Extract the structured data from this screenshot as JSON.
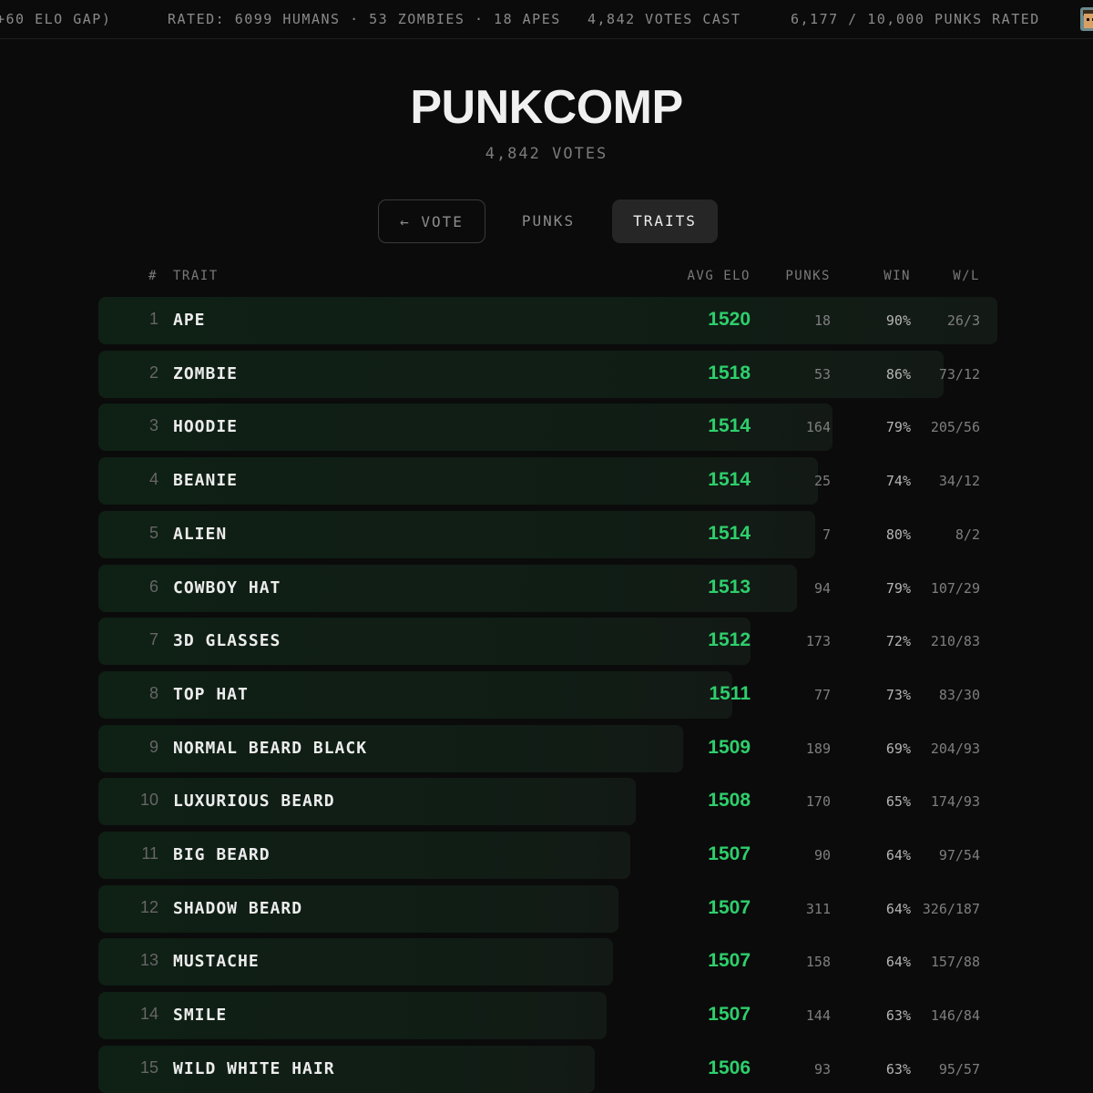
{
  "ticker": {
    "elo_gap": "+60 ELO GAP)",
    "rated": "RATED: 6099 HUMANS · 53 ZOMBIES · 18 APES",
    "votes_cast": "4,842 VOTES CAST",
    "punks_rated": "6,177 / 10,000 PUNKS RATED"
  },
  "header": {
    "title": "PUNKCOMP",
    "subtitle": "4,842 VOTES"
  },
  "tabs": {
    "vote": "← VOTE",
    "punks": "PUNKS",
    "traits": "TRAITS",
    "active": "traits"
  },
  "columns": {
    "rank": "#",
    "trait": "TRAIT",
    "avg_elo": "AVG ELO",
    "punks": "PUNKS",
    "win": "WIN",
    "wl": "W/L"
  },
  "accent_color": "#2ecf6c",
  "traits": [
    {
      "rank": "1",
      "name": "APE",
      "elo": "1520",
      "punks": "18",
      "win": "90%",
      "wl": "26/3"
    },
    {
      "rank": "2",
      "name": "ZOMBIE",
      "elo": "1518",
      "punks": "53",
      "win": "86%",
      "wl": "73/12"
    },
    {
      "rank": "3",
      "name": "HOODIE",
      "elo": "1514",
      "punks": "164",
      "win": "79%",
      "wl": "205/56"
    },
    {
      "rank": "4",
      "name": "BEANIE",
      "elo": "1514",
      "punks": "25",
      "win": "74%",
      "wl": "34/12"
    },
    {
      "rank": "5",
      "name": "ALIEN",
      "elo": "1514",
      "punks": "7",
      "win": "80%",
      "wl": "8/2"
    },
    {
      "rank": "6",
      "name": "COWBOY HAT",
      "elo": "1513",
      "punks": "94",
      "win": "79%",
      "wl": "107/29"
    },
    {
      "rank": "7",
      "name": "3D GLASSES",
      "elo": "1512",
      "punks": "173",
      "win": "72%",
      "wl": "210/83"
    },
    {
      "rank": "8",
      "name": "TOP HAT",
      "elo": "1511",
      "punks": "77",
      "win": "73%",
      "wl": "83/30"
    },
    {
      "rank": "9",
      "name": "NORMAL BEARD BLACK",
      "elo": "1509",
      "punks": "189",
      "win": "69%",
      "wl": "204/93"
    },
    {
      "rank": "10",
      "name": "LUXURIOUS BEARD",
      "elo": "1508",
      "punks": "170",
      "win": "65%",
      "wl": "174/93"
    },
    {
      "rank": "11",
      "name": "BIG BEARD",
      "elo": "1507",
      "punks": "90",
      "win": "64%",
      "wl": "97/54"
    },
    {
      "rank": "12",
      "name": "SHADOW BEARD",
      "elo": "1507",
      "punks": "311",
      "win": "64%",
      "wl": "326/187"
    },
    {
      "rank": "13",
      "name": "MUSTACHE",
      "elo": "1507",
      "punks": "158",
      "win": "64%",
      "wl": "157/88"
    },
    {
      "rank": "14",
      "name": "SMILE",
      "elo": "1507",
      "punks": "144",
      "win": "63%",
      "wl": "146/84"
    },
    {
      "rank": "15",
      "name": "WILD WHITE HAIR",
      "elo": "1506",
      "punks": "93",
      "win": "63%",
      "wl": "95/57"
    }
  ]
}
